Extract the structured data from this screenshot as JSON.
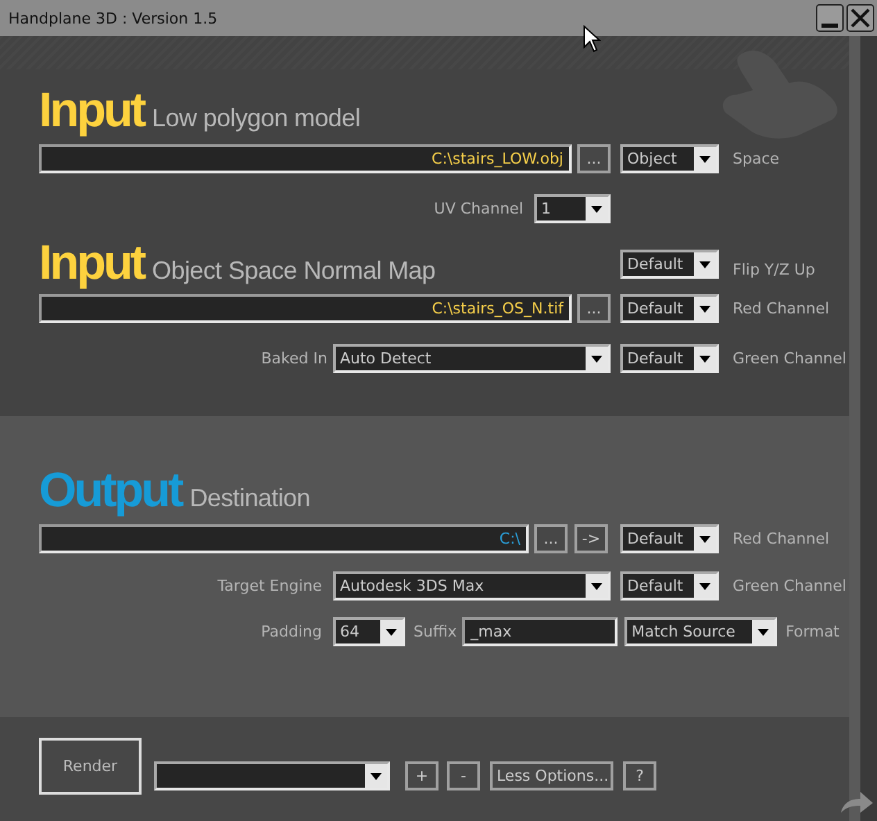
{
  "window": {
    "title": "Handplane 3D : Version 1.5"
  },
  "input_model": {
    "heading": "Input",
    "subtitle": "Low polygon model",
    "path": "C:\\stairs_LOW.obj",
    "browse": "...",
    "space": {
      "value": "Object",
      "label": "Space"
    },
    "uv_channel": {
      "label": "UV Channel",
      "value": "1"
    }
  },
  "input_normal": {
    "heading": "Input",
    "subtitle": "Object Space Normal Map",
    "flip_yz": {
      "value": "Default",
      "label": "Flip Y/Z Up"
    },
    "path": "C:\\stairs_OS_N.tif",
    "browse": "...",
    "red_channel": {
      "value": "Default",
      "label": "Red Channel"
    },
    "baked_in": {
      "label": "Baked In",
      "value": "Auto Detect"
    },
    "green_channel": {
      "value": "Default",
      "label": "Green Channel"
    }
  },
  "output": {
    "heading": "Output",
    "subtitle": "Destination",
    "path": "C:\\",
    "browse": "...",
    "open": "->",
    "red_channel": {
      "value": "Default",
      "label": "Red Channel"
    },
    "target_engine": {
      "label": "Target Engine",
      "value": "Autodesk 3DS Max"
    },
    "green_channel": {
      "value": "Default",
      "label": "Green Channel"
    },
    "padding": {
      "label": "Padding",
      "value": "64"
    },
    "suffix": {
      "label": "Suffix",
      "value": "_max"
    },
    "format": {
      "value": "Match Source",
      "label": "Format"
    }
  },
  "footer": {
    "render": "Render",
    "add": "+",
    "remove": "-",
    "less_options": "Less Options...",
    "help": "?"
  }
}
